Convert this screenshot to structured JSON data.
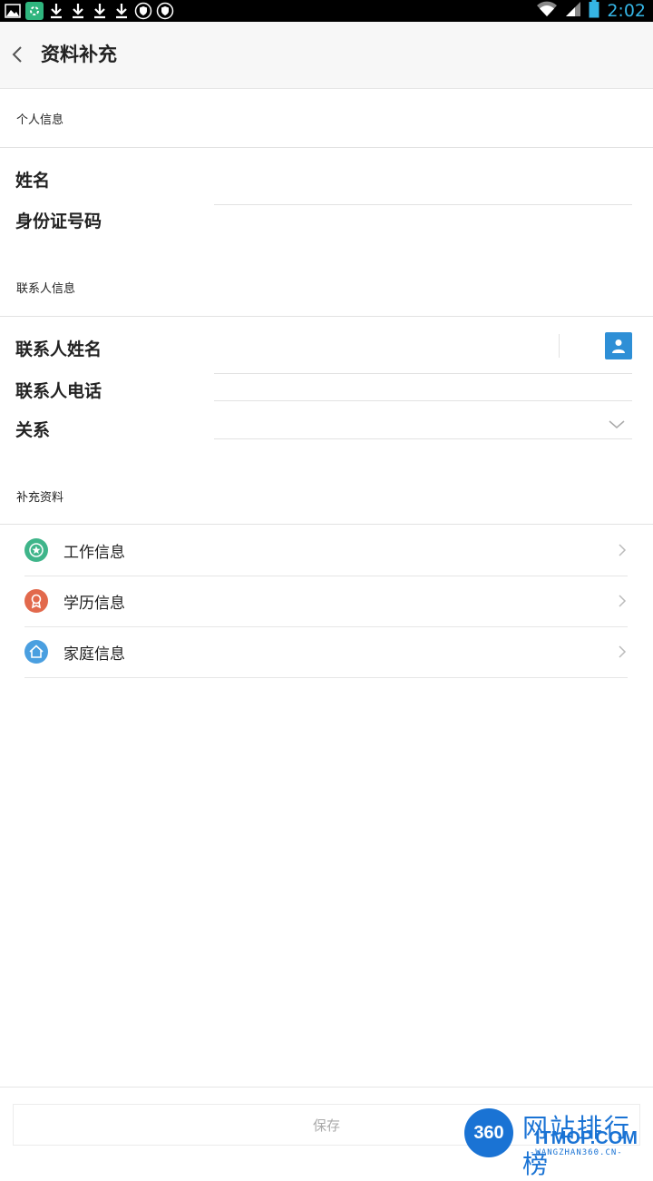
{
  "status_bar": {
    "time": "2:02",
    "icons": [
      "image-icon",
      "app-icon",
      "download-icon",
      "download-icon",
      "download-icon",
      "download-icon",
      "shield-icon",
      "shield-icon",
      "wifi-icon",
      "signal-icon",
      "battery-icon"
    ]
  },
  "header": {
    "title": "资料补充"
  },
  "personal": {
    "section_title": "个人信息",
    "name_label": "姓名",
    "id_label": "身份证号码",
    "name_value": "",
    "id_value": ""
  },
  "contact": {
    "section_title": "联系人信息",
    "name_label": "联系人姓名",
    "phone_label": "联系人电话",
    "relation_label": "关系",
    "name_value": "",
    "phone_value": "",
    "relation_value": ""
  },
  "supplement": {
    "section_title": "补充资料",
    "items": [
      {
        "label": "工作信息",
        "icon": "star-badge-icon",
        "color": "#3fb58a"
      },
      {
        "label": "学历信息",
        "icon": "award-icon",
        "color": "#e2694c"
      },
      {
        "label": "家庭信息",
        "icon": "home-icon",
        "color": "#4a9fe0"
      }
    ]
  },
  "footer": {
    "save_label": "保存"
  },
  "watermark": {
    "badge": "360",
    "cn": "网站排行榜",
    "en": "ITMOP.COM",
    "small": "-WANGZHAN360.CN-"
  },
  "colors": {
    "accent": "#35b5e5",
    "contact_button": "#2e8fd6"
  }
}
